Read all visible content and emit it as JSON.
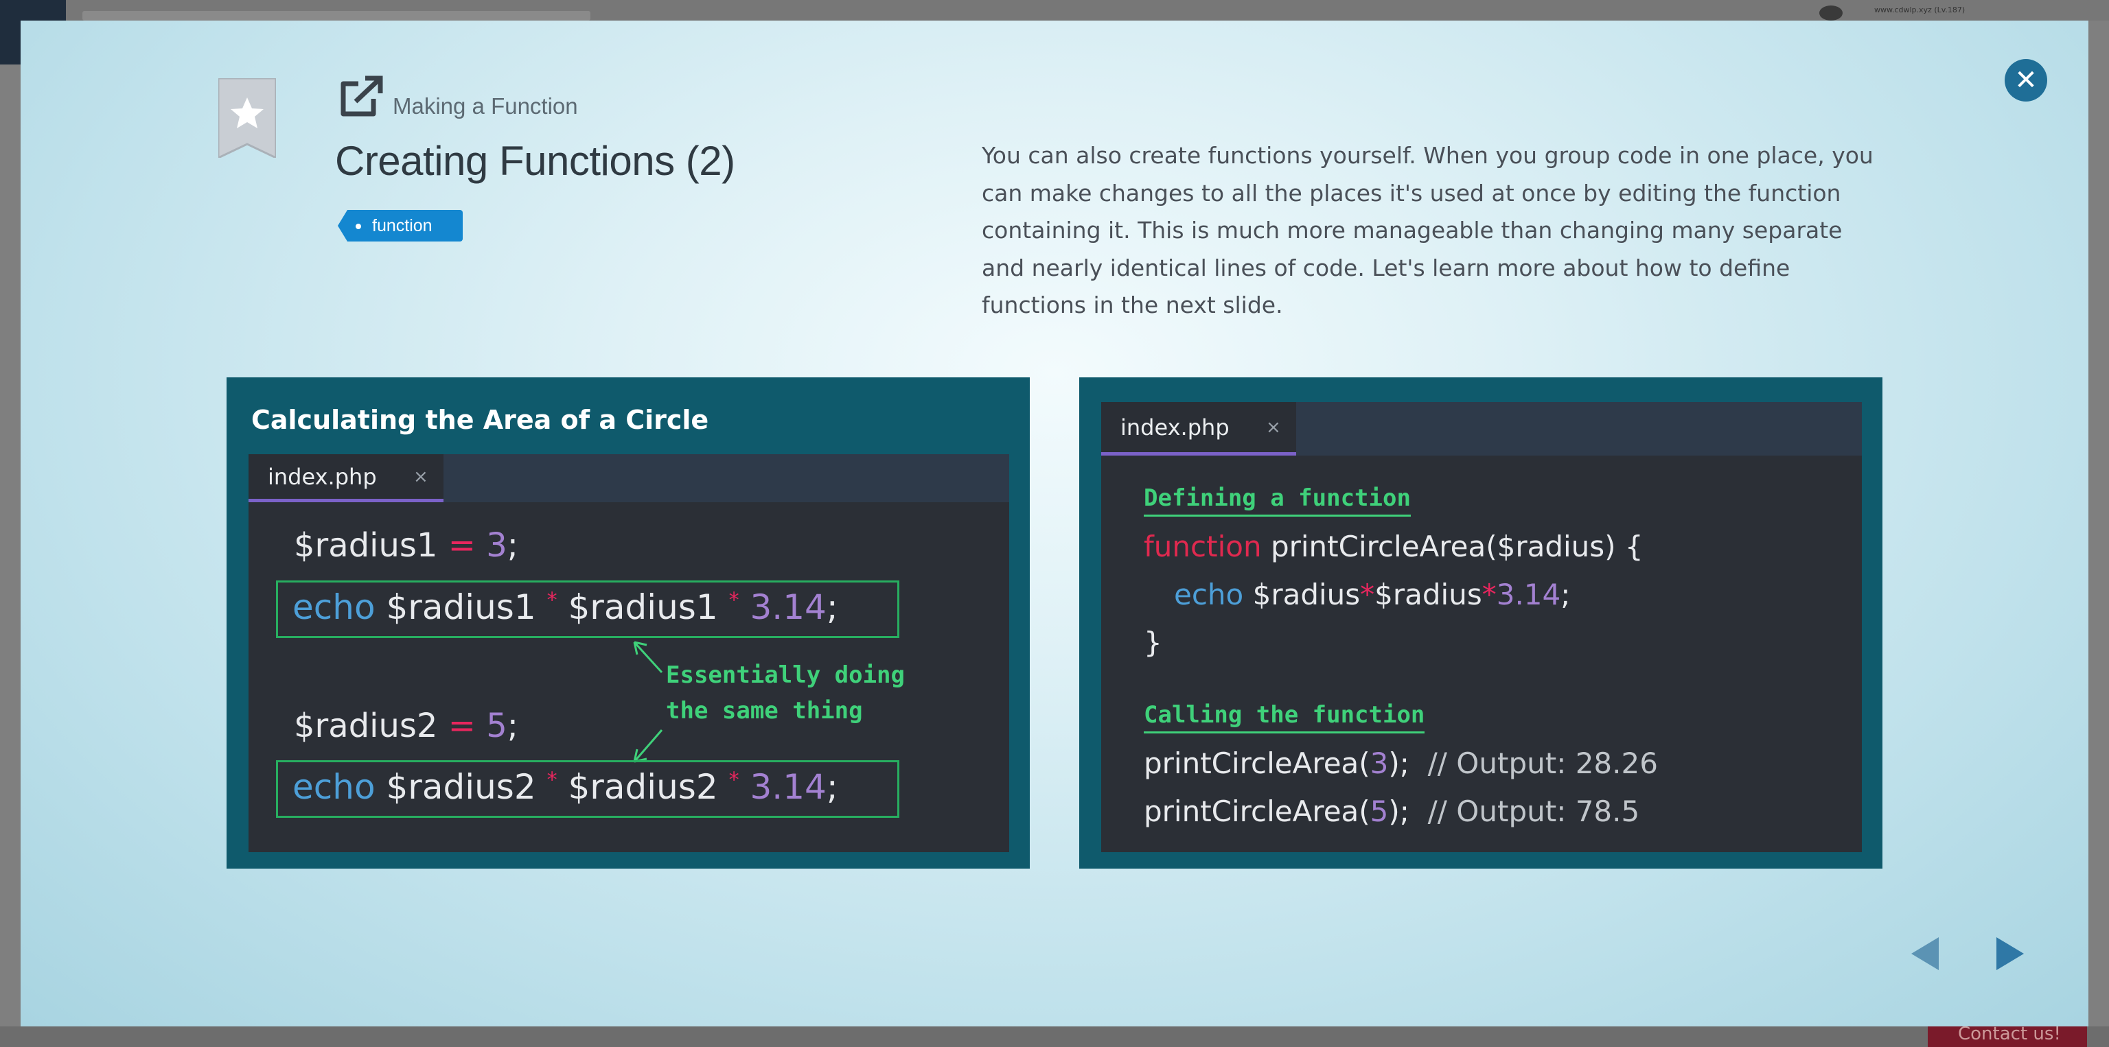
{
  "background": {
    "user_text": "www.cdwlp.xyz (Lv.187)",
    "contact_label": "Contact us!"
  },
  "header": {
    "subtitle": "Making a Function",
    "title": "Creating Functions (2)",
    "tag": "function"
  },
  "description": "You can also create functions yourself. When you group code in one place, you can make changes to all the places it's used at once by editing the function containing it. This is much more manageable than changing many separate and nearly identical lines of code. Let's learn more about how to define functions in the next slide.",
  "slide_left": {
    "caption": "Calculating the Area of a Circle",
    "tab": "index.php",
    "tab_close": "×",
    "line1": {
      "var": "$radius1",
      "op": "=",
      "num": "3",
      "end": ";"
    },
    "line2": {
      "kw": "echo",
      "a": "$radius1",
      "op1": "*",
      "b": "$radius1",
      "op2": "*",
      "num": "3.14",
      "end": ";"
    },
    "line3": {
      "var": "$radius2",
      "op": "=",
      "num": "5",
      "end": ";"
    },
    "line4": {
      "kw": "echo",
      "a": "$radius2",
      "op1": "*",
      "b": "$radius2",
      "op2": "*",
      "num": "3.14",
      "end": ";"
    },
    "note": "Essentially doing\nthe same thing"
  },
  "slide_right": {
    "tab": "index.php",
    "tab_close": "×",
    "label_define": "Defining a function",
    "def_kw": "function",
    "def_sig": "printCircleArea($radius) {",
    "body_kw": "echo",
    "body_a": "$radius",
    "body_op1": "*",
    "body_b": "$radius",
    "body_op2": "*",
    "body_num": "3.14",
    "body_end": ";",
    "close_brace": "}",
    "label_call": "Calling the function",
    "call1_fn": "printCircleArea(",
    "call1_num": "3",
    "call1_end": ");",
    "call1_cmt": "// Output: 28.26",
    "call2_fn": "printCircleArea(",
    "call2_num": "5",
    "call2_end": ");",
    "call2_cmt": "// Output: 78.5"
  },
  "icons": {
    "close": "close-icon",
    "bookmark": "bookmark-star-icon",
    "external": "external-link-icon",
    "prev": "previous-arrow-icon",
    "next": "next-arrow-icon"
  },
  "colors": {
    "accent": "#1487d0",
    "slide_bg": "#0f5a6c",
    "editor_bg": "#2b2f36",
    "keyword": "#4d9fd8",
    "operator": "#e8265e",
    "number": "#a381d1",
    "annotation": "#3fd17a"
  }
}
